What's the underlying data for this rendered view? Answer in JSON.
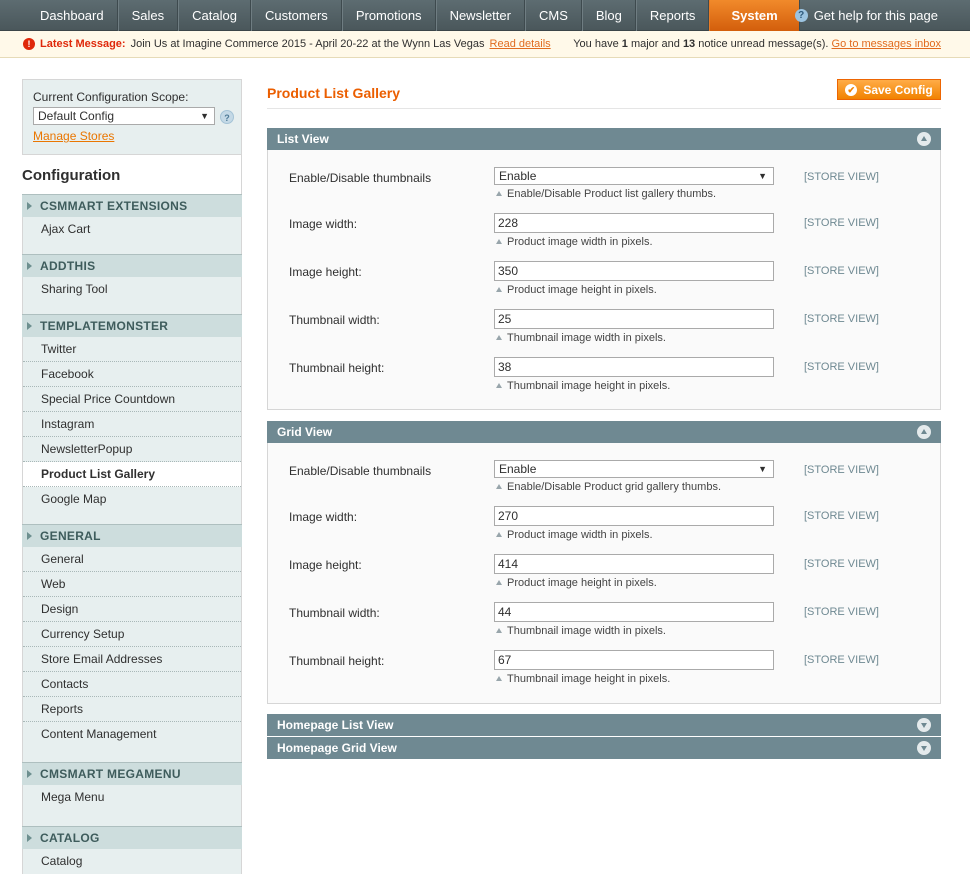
{
  "nav": {
    "items": [
      {
        "label": "Dashboard"
      },
      {
        "label": "Sales"
      },
      {
        "label": "Catalog"
      },
      {
        "label": "Customers"
      },
      {
        "label": "Promotions"
      },
      {
        "label": "Newsletter"
      },
      {
        "label": "CMS"
      },
      {
        "label": "Blog"
      },
      {
        "label": "Reports"
      },
      {
        "label": "System"
      }
    ],
    "active_index": 9,
    "help": "Get help for this page"
  },
  "message": {
    "label": "Latest Message:",
    "text": "Join Us at Imagine Commerce 2015 - April 20-22 at the Wynn Las Vegas",
    "read_details": "Read details",
    "summary_pre": "You have",
    "major_count": "1",
    "summary_mid": "major and",
    "notice_count": "13",
    "summary_post": "notice unread message(s).",
    "goto_link": "Go to messages inbox"
  },
  "sidebar": {
    "scope_label": "Current Configuration Scope:",
    "scope_value": "Default Config",
    "manage_stores": "Manage Stores",
    "config_title": "Configuration",
    "sections": [
      {
        "title": "CSMMART EXTENSIONS",
        "items": [
          "Ajax Cart"
        ]
      },
      {
        "title": "ADDTHIS",
        "items": [
          "Sharing Tool"
        ]
      },
      {
        "title": "TEMPLATEMONSTER",
        "items": [
          "Twitter",
          "Facebook",
          "Special Price Countdown",
          "Instagram",
          "NewsletterPopup",
          "Product List Gallery",
          "Google Map"
        ]
      },
      {
        "title": "GENERAL",
        "items": [
          "General",
          "Web",
          "Design",
          "Currency Setup",
          "Store Email Addresses",
          "Contacts",
          "Reports",
          "Content Management"
        ]
      },
      {
        "title": "CMSMART MEGAMENU",
        "items": [
          "Mega Menu"
        ]
      },
      {
        "title": "CATALOG",
        "items": [
          "Catalog"
        ]
      }
    ],
    "active_item": "Product List Gallery"
  },
  "main": {
    "title": "Product List Gallery",
    "save_label": "Save Config",
    "list_view": {
      "title": "List View",
      "fields": [
        {
          "label": "Enable/Disable thumbnails",
          "value": "Enable",
          "note": "Enable/Disable Product list gallery thumbs.",
          "scope": "[STORE VIEW]"
        },
        {
          "label": "Image width:",
          "value": "228",
          "note": "Product image width in pixels.",
          "scope": "[STORE VIEW]"
        },
        {
          "label": "Image height:",
          "value": "350",
          "note": "Product image height in pixels.",
          "scope": "[STORE VIEW]"
        },
        {
          "label": "Thumbnail width:",
          "value": "25",
          "note": "Thumbnail image width in pixels.",
          "scope": "[STORE VIEW]"
        },
        {
          "label": "Thumbnail height:",
          "value": "38",
          "note": "Thumbnail image height in pixels.",
          "scope": "[STORE VIEW]"
        }
      ]
    },
    "grid_view": {
      "title": "Grid View",
      "fields": [
        {
          "label": "Enable/Disable thumbnails",
          "value": "Enable",
          "note": "Enable/Disable Product grid gallery thumbs.",
          "scope": "[STORE VIEW]"
        },
        {
          "label": "Image width:",
          "value": "270",
          "note": "Product image width in pixels.",
          "scope": "[STORE VIEW]"
        },
        {
          "label": "Image height:",
          "value": "414",
          "note": "Product image height in pixels.",
          "scope": "[STORE VIEW]"
        },
        {
          "label": "Thumbnail width:",
          "value": "44",
          "note": "Thumbnail image width in pixels.",
          "scope": "[STORE VIEW]"
        },
        {
          "label": "Thumbnail height:",
          "value": "67",
          "note": "Thumbnail image height in pixels.",
          "scope": "[STORE VIEW]"
        }
      ]
    },
    "homepage_list_view": {
      "title": "Homepage List View"
    },
    "homepage_grid_view": {
      "title": "Homepage Grid View"
    }
  },
  "colors": {
    "accent": "#eb5e00",
    "nav_active": "#e7751a",
    "fieldset_header": "#6f8992",
    "sidebar_bg": "#e7efef"
  },
  "icons": {
    "help": "help-circle-icon",
    "message": "error-circle-icon",
    "scope_help": "question-icon",
    "save": "check-circle-icon",
    "collapse": "chevron-up-circle-icon",
    "expand": "chevron-down-circle-icon"
  }
}
